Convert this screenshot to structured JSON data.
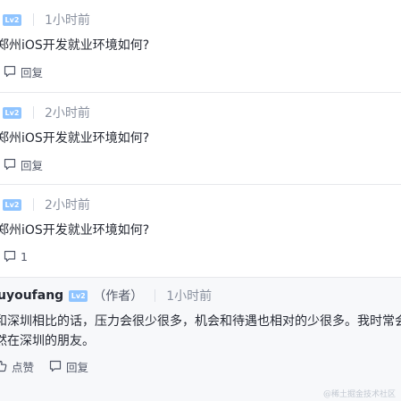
{
  "colors": {
    "level_badge_bg": "#8fc4ff",
    "text_primary": "#252933",
    "text_secondary": "#8a919f",
    "divider": "#e6e8eb",
    "highlight_bg": "#f7f8fa"
  },
  "comments": [
    {
      "level_badge": "Lv2",
      "time": "1小时前",
      "content": "郑州iOS开发就业环境如何?",
      "reply_icon": "comment-bubble-icon",
      "reply_label": "回复"
    },
    {
      "level_badge": "Lv2",
      "time": "2小时前",
      "content": "郑州iOS开发就业环境如何?",
      "reply_icon": "comment-bubble-icon",
      "reply_label": "回复"
    },
    {
      "level_badge": "Lv2",
      "time": "2小时前",
      "content": "郑州iOS开发就业环境如何?",
      "reply_icon": "comment-bubble-icon",
      "reply_label": "1"
    }
  ],
  "reply": {
    "username": "uyoufang",
    "level_badge": "Lv2",
    "author_tag": "（作者）",
    "time": "1小时前",
    "content_line1": "和深圳相比的话，压力会很少很多，机会和待遇也相对的少很多。我时常会",
    "content_line2": "然在深圳的朋友。",
    "like_icon": "thumbs-up-icon",
    "like_label": "点赞",
    "reply_icon": "comment-bubble-icon",
    "reply_label": "回复"
  },
  "watermark": "@稀土掘金技术社区"
}
